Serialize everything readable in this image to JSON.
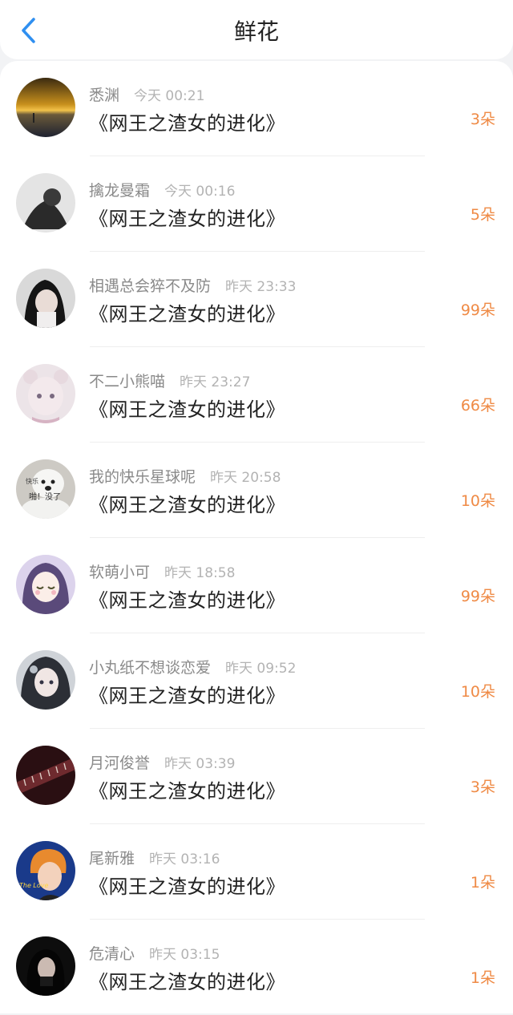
{
  "header": {
    "title": "鲜花"
  },
  "list": [
    {
      "user": "悉渊",
      "time": "今天 00:21",
      "book": "《网王之渣女的进化》",
      "amount": "3朵"
    },
    {
      "user": "擒龙曼霜",
      "time": "今天 00:16",
      "book": "《网王之渣女的进化》",
      "amount": "5朵"
    },
    {
      "user": "相遇总会猝不及防",
      "time": "昨天 23:33",
      "book": "《网王之渣女的进化》",
      "amount": "99朵"
    },
    {
      "user": "不二小熊喵",
      "time": "昨天 23:27",
      "book": "《网王之渣女的进化》",
      "amount": "66朵"
    },
    {
      "user": "我的快乐星球呢",
      "time": "昨天 20:58",
      "book": "《网王之渣女的进化》",
      "amount": "10朵"
    },
    {
      "user": "软萌小可",
      "time": "昨天 18:58",
      "book": "《网王之渣女的进化》",
      "amount": "99朵"
    },
    {
      "user": "小丸纸不想谈恋爱",
      "time": "昨天 09:52",
      "book": "《网王之渣女的进化》",
      "amount": "10朵"
    },
    {
      "user": "月河俊誉",
      "time": "昨天 03:39",
      "book": "《网王之渣女的进化》",
      "amount": "3朵"
    },
    {
      "user": "尾新雅",
      "time": "昨天 03:16",
      "book": "《网王之渣女的进化》",
      "amount": "1朵"
    },
    {
      "user": "危清心",
      "time": "昨天 03:15",
      "book": "《网王之渣女的进化》",
      "amount": "1朵"
    }
  ],
  "avatar_text": {
    "dog_line1": "快乐",
    "dog_line2": "啪！没了",
    "boy_text": "The Love"
  },
  "colors": {
    "accent": "#ef8a45",
    "back": "#2f8ff0"
  }
}
